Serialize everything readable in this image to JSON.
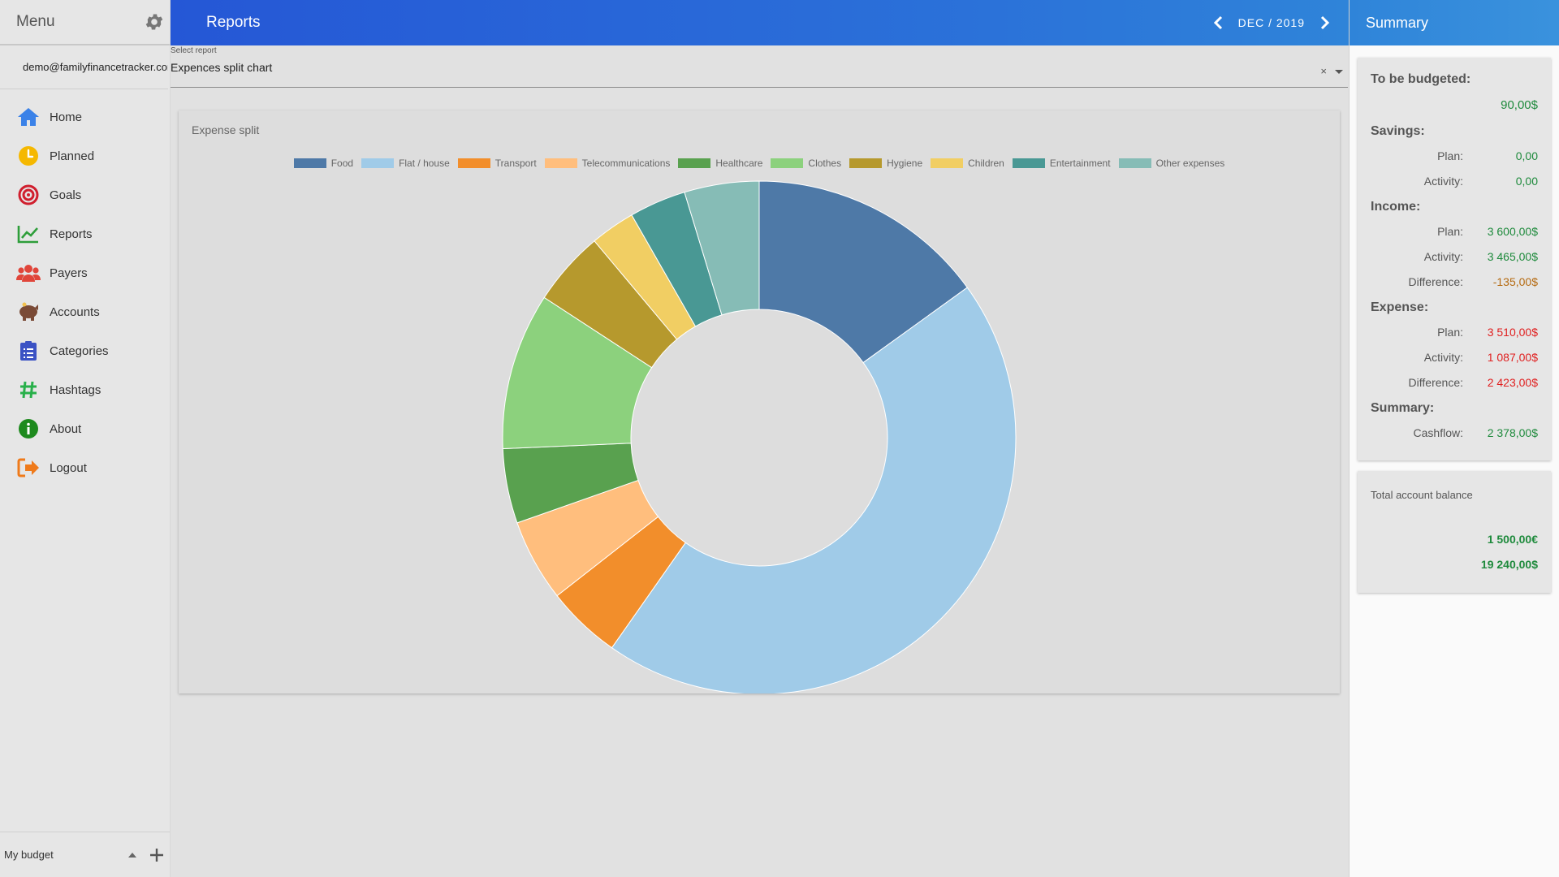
{
  "sidebar": {
    "title": "Menu",
    "user_email": "demo@familyfinancetracker.com",
    "items": [
      {
        "label": "Home",
        "icon": "home-icon",
        "color": "#3b82e8"
      },
      {
        "label": "Planned",
        "icon": "clock-icon",
        "color": "#f5b800"
      },
      {
        "label": "Goals",
        "icon": "target-icon",
        "color": "#d01f2e"
      },
      {
        "label": "Reports",
        "icon": "chart-line-icon",
        "color": "#2e9e3a"
      },
      {
        "label": "Payers",
        "icon": "users-icon",
        "color": "#e0453a"
      },
      {
        "label": "Accounts",
        "icon": "piggy-bank-icon",
        "color": "#7a4a36"
      },
      {
        "label": "Categories",
        "icon": "clipboard-list-icon",
        "color": "#3b52c4"
      },
      {
        "label": "Hashtags",
        "icon": "hashtag-icon",
        "color": "#28b04a"
      },
      {
        "label": "About",
        "icon": "info-icon",
        "color": "#1e8a1e"
      },
      {
        "label": "Logout",
        "icon": "logout-icon",
        "color": "#ef7a1a"
      }
    ],
    "footer": {
      "budget_label": "My budget"
    }
  },
  "topbar": {
    "title": "Reports",
    "month": "DEC / 2019"
  },
  "report_select": {
    "caption": "Select report",
    "value": "Expences split chart",
    "clear": "×"
  },
  "chart_data": {
    "type": "pie",
    "title": "Expense split",
    "donut": true,
    "categories": [
      "Food",
      "Flat / house",
      "Transport",
      "Telecommunications",
      "Healthcare",
      "Clothes",
      "Hygiene",
      "Children",
      "Entertainment",
      "Other expenses"
    ],
    "values": [
      16.0,
      47.5,
      5.0,
      5.5,
      5.0,
      10.5,
      5.0,
      3.0,
      3.8,
      5.0
    ],
    "colors": [
      "#4e79a7",
      "#a0cbe8",
      "#f28e2b",
      "#ffbe7d",
      "#59a14f",
      "#8cd17d",
      "#b6992d",
      "#f1ce63",
      "#499894",
      "#86bcb6"
    ],
    "legend_position": "top"
  },
  "summary": {
    "title": "Summary",
    "to_be_budgeted_label": "To be budgeted:",
    "to_be_budgeted_value": "90,00$",
    "savings_label": "Savings:",
    "savings_plan_label": "Plan:",
    "savings_plan": "0,00",
    "savings_activity_label": "Activity:",
    "savings_activity": "0,00",
    "income_label": "Income:",
    "income_plan_label": "Plan:",
    "income_plan": "3 600,00$",
    "income_activity_label": "Activity:",
    "income_activity": "3 465,00$",
    "income_diff_label": "Difference:",
    "income_diff": "-135,00$",
    "expense_label": "Expense:",
    "expense_plan_label": "Plan:",
    "expense_plan": "3 510,00$",
    "expense_activity_label": "Activity:",
    "expense_activity": "1 087,00$",
    "expense_diff_label": "Difference:",
    "expense_diff": "2 423,00$",
    "summary_label": "Summary:",
    "cashflow_label": "Cashflow:",
    "cashflow": "2 378,00$"
  },
  "balance": {
    "title": "Total account balance",
    "amount_eur": "1 500,00€",
    "amount_usd": "19 240,00$"
  }
}
